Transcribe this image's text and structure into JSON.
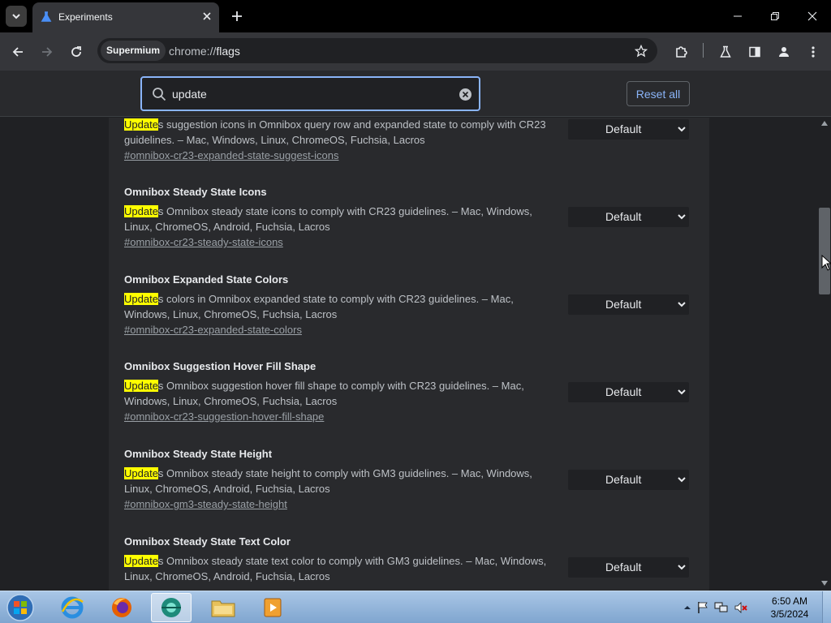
{
  "tabs": {
    "active_title": "Experiments"
  },
  "toolbar": {
    "site_chip": "Supermium",
    "url_scheme": "chrome://",
    "url_path": "flags"
  },
  "flags_header": {
    "search_value": "update",
    "reset_label": "Reset all"
  },
  "highlight_term": "Update",
  "flags": [
    {
      "name": "",
      "desc_rest": "s suggestion icons in Omnibox query row and expanded state to comply with CR23 guidelines. – Mac, Windows, Linux, ChromeOS, Fuchsia, Lacros",
      "link": "#omnibox-cr23-expanded-state-suggest-icons",
      "value": "Default"
    },
    {
      "name": "Omnibox Steady State Icons",
      "desc_rest": "s Omnibox steady state icons to comply with CR23 guidelines. – Mac, Windows, Linux, ChromeOS, Android, Fuchsia, Lacros",
      "link": "#omnibox-cr23-steady-state-icons",
      "value": "Default"
    },
    {
      "name": "Omnibox Expanded State Colors",
      "desc_rest": "s colors in Omnibox expanded state to comply with CR23 guidelines. – Mac, Windows, Linux, ChromeOS, Fuchsia, Lacros",
      "link": "#omnibox-cr23-expanded-state-colors",
      "value": "Default"
    },
    {
      "name": "Omnibox Suggestion Hover Fill Shape",
      "desc_rest": "s Omnibox suggestion hover fill shape to comply with CR23 guidelines. – Mac, Windows, Linux, ChromeOS, Fuchsia, Lacros",
      "link": "#omnibox-cr23-suggestion-hover-fill-shape",
      "value": "Default"
    },
    {
      "name": "Omnibox Steady State Height",
      "desc_rest": "s Omnibox steady state height to comply with GM3 guidelines. – Mac, Windows, Linux, ChromeOS, Android, Fuchsia, Lacros",
      "link": "#omnibox-gm3-steady-state-height",
      "value": "Default"
    },
    {
      "name": "Omnibox Steady State Text Color",
      "desc_rest": "s Omnibox steady state text color to comply with GM3 guidelines. – Mac, Windows, Linux, ChromeOS, Android, Fuchsia, Lacros",
      "link": "",
      "value": "Default"
    }
  ],
  "taskbar": {
    "time": "6:50 AM",
    "date": "3/5/2024"
  },
  "colors": {
    "highlight": "#ffff00",
    "accent": "#8ab4f8",
    "panel": "#292a2d",
    "page": "#202124"
  }
}
